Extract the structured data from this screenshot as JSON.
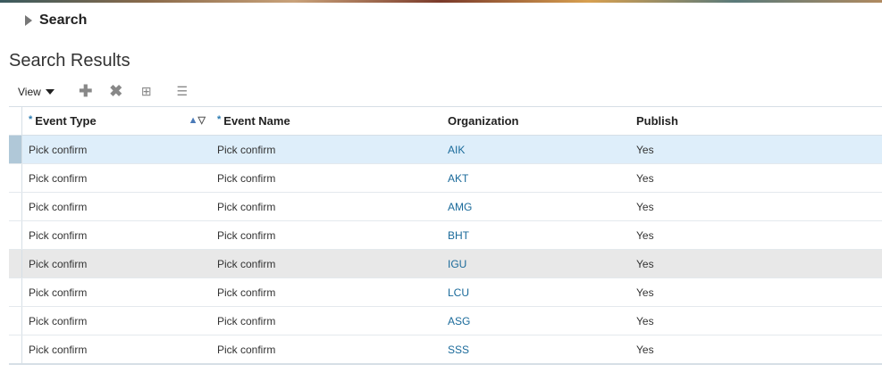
{
  "search_section": {
    "label": "Search"
  },
  "results": {
    "title": "Search Results"
  },
  "toolbar": {
    "view_label": "View",
    "icons": [
      "add-icon",
      "delete-icon",
      "freeze-icon",
      "query-by-example-icon"
    ]
  },
  "columns": [
    "Event Type",
    "Event Name",
    "Organization",
    "Publish"
  ],
  "rows": [
    {
      "event_type": "Pick confirm",
      "event_name": "Pick confirm",
      "organization": "AIK",
      "publish": "Yes"
    },
    {
      "event_type": "Pick confirm",
      "event_name": "Pick confirm",
      "organization": "AKT",
      "publish": "Yes"
    },
    {
      "event_type": "Pick confirm",
      "event_name": "Pick confirm",
      "organization": "AMG",
      "publish": "Yes"
    },
    {
      "event_type": "Pick confirm",
      "event_name": "Pick confirm",
      "organization": "BHT",
      "publish": "Yes"
    },
    {
      "event_type": "Pick confirm",
      "event_name": "Pick confirm",
      "organization": "IGU",
      "publish": "Yes"
    },
    {
      "event_type": "Pick confirm",
      "event_name": "Pick confirm",
      "organization": "LCU",
      "publish": "Yes"
    },
    {
      "event_type": "Pick confirm",
      "event_name": "Pick confirm",
      "organization": "ASG",
      "publish": "Yes"
    },
    {
      "event_type": "Pick confirm",
      "event_name": "Pick confirm",
      "organization": "SSS",
      "publish": "Yes"
    }
  ]
}
